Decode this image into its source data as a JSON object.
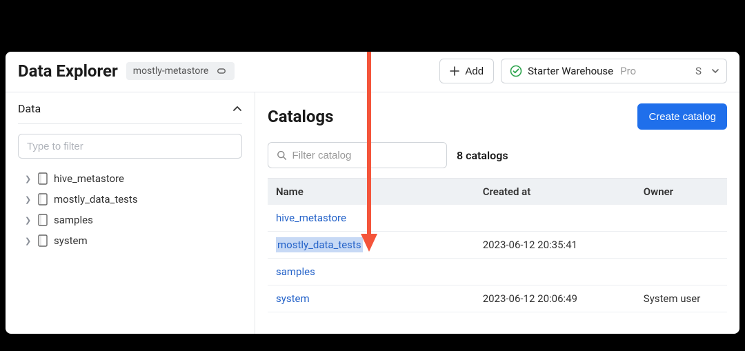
{
  "header": {
    "title": "Data Explorer",
    "metastore_chip": "mostly-metastore",
    "add_label": "Add",
    "warehouse_name": "Starter Warehouse",
    "warehouse_badge": "Pro",
    "warehouse_suffix": "S"
  },
  "sidebar": {
    "section_label": "Data",
    "filter_placeholder": "Type to filter",
    "items": [
      {
        "label": "hive_metastore"
      },
      {
        "label": "mostly_data_tests"
      },
      {
        "label": "samples"
      },
      {
        "label": "system"
      }
    ]
  },
  "main": {
    "title": "Catalogs",
    "create_label": "Create catalog",
    "filter_placeholder": "Filter catalog",
    "count_text": "8 catalogs",
    "columns": {
      "name": "Name",
      "created_at": "Created at",
      "owner": "Owner"
    },
    "rows": [
      {
        "name": "hive_metastore",
        "created_at": "",
        "owner": "",
        "highlight": false
      },
      {
        "name": "mostly_data_tests",
        "created_at": "2023-06-12 20:35:41",
        "owner": "",
        "highlight": true
      },
      {
        "name": "samples",
        "created_at": "",
        "owner": "",
        "highlight": false
      },
      {
        "name": "system",
        "created_at": "2023-06-12 20:06:49",
        "owner": "System user",
        "highlight": false
      }
    ]
  }
}
